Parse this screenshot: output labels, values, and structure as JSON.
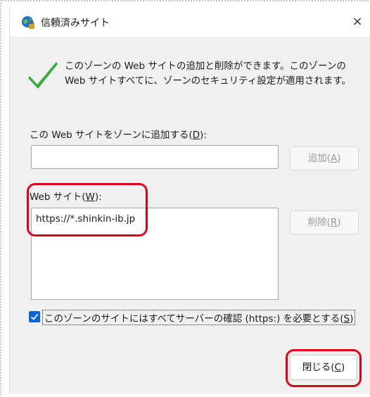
{
  "dialog": {
    "title": "信頼済みサイト",
    "close_glyph": "×",
    "app_icon": "globe-lock-icon"
  },
  "info": {
    "icon": "checkmark-icon",
    "text": "このゾーンの Web サイトの追加と削除ができます。このゾーンの Web サイトすべてに、ゾーンのセキュリティ設定が適用されます。"
  },
  "add_section": {
    "label_prefix": "この Web サイトをゾーンに追加する(",
    "label_key": "D",
    "label_suffix": "):",
    "input_value": "",
    "button_prefix": "追加(",
    "button_key": "A",
    "button_suffix": ")"
  },
  "sites_section": {
    "label_prefix": "Web サイト(",
    "label_key": "W",
    "label_suffix": "):",
    "items": [
      "https://*.shinkin-ib.jp"
    ],
    "remove_prefix": "削除(",
    "remove_key": "R",
    "remove_suffix": ")"
  },
  "https_option": {
    "checked": true,
    "label_prefix": "このゾーンのサイトにはすべてサーバーの確認 (https:) を必要とする(",
    "label_key": "S",
    "label_suffix": ")"
  },
  "footer": {
    "close_prefix": "閉じる(",
    "close_key": "C",
    "close_suffix": ")"
  },
  "colors": {
    "highlight": "#e0001b",
    "checkbox": "#0a64d8",
    "check_icon": "#3daa3d"
  }
}
